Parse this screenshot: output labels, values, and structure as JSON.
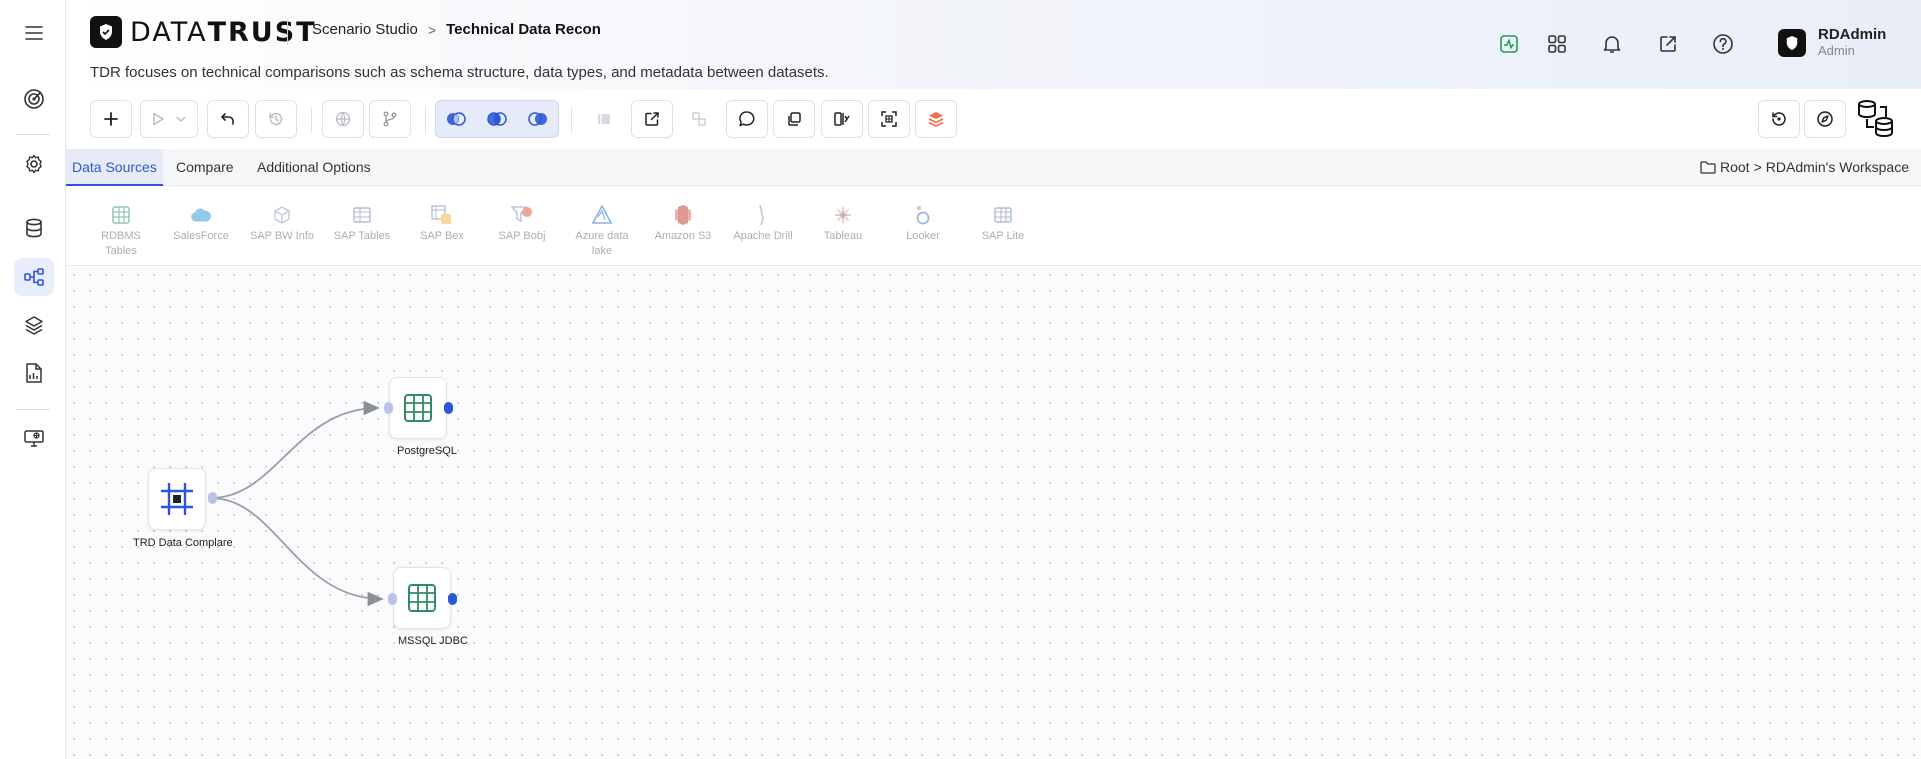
{
  "sidebar": {
    "items": [
      {
        "name": "menu-icon"
      },
      {
        "name": "target-icon"
      },
      {
        "name": "settings-icon"
      },
      {
        "name": "database-icon"
      },
      {
        "name": "workflow-icon"
      },
      {
        "name": "layers-icon"
      },
      {
        "name": "report-icon"
      },
      {
        "name": "monitor-icon"
      }
    ]
  },
  "header": {
    "logo_bold": "DATA",
    "logo_light": "TRUST",
    "breadcrumb_parent": "Scenario Studio",
    "breadcrumb_sep": ">",
    "breadcrumb_current": "Technical Data Recon",
    "subtitle": "TDR focuses on technical comparisons such as schema structure, data types, and metadata between datasets.",
    "user_name": "RDAdmin",
    "user_role": "Admin",
    "accent": "#2d57d6"
  },
  "tabs": [
    {
      "label": "Data Sources"
    },
    {
      "label": "Compare"
    },
    {
      "label": "Additional Options"
    }
  ],
  "workspace": {
    "root": "Root",
    "sep": ">",
    "name": "RDAdmin's Workspace"
  },
  "data_sources": [
    {
      "label": "RDBMS Tables"
    },
    {
      "label": "SalesForce"
    },
    {
      "label": "SAP BW Info"
    },
    {
      "label": "SAP Tables"
    },
    {
      "label": "SAP Bex"
    },
    {
      "label": "SAP Bobj"
    },
    {
      "label": "Azure data lake"
    },
    {
      "label": "Amazon S3"
    },
    {
      "label": "Apache Drill"
    },
    {
      "label": "Tableau"
    },
    {
      "label": "Looker"
    },
    {
      "label": "SAP Lite"
    }
  ],
  "canvas": {
    "nodes": [
      {
        "label": "TRD Data Complare"
      },
      {
        "label": "PostgreSQL"
      },
      {
        "label": "MSSQL JDBC"
      }
    ]
  }
}
